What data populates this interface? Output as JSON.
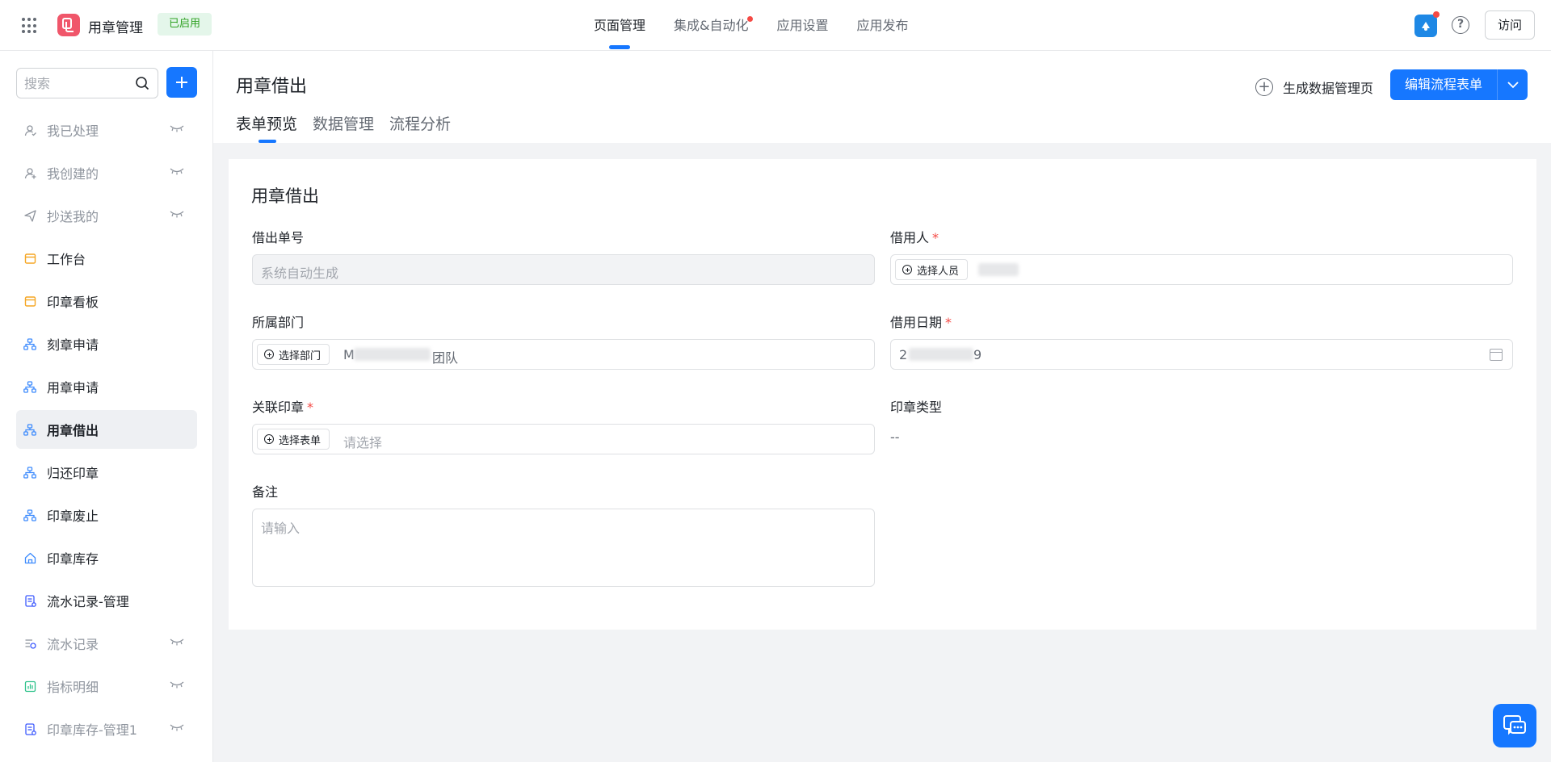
{
  "app": {
    "name": "用章管理",
    "status": "已启用"
  },
  "top_nav": [
    {
      "label": "页面管理",
      "active": true,
      "dot": false
    },
    {
      "label": "集成&自动化",
      "active": false,
      "dot": true
    },
    {
      "label": "应用设置",
      "active": false,
      "dot": false
    },
    {
      "label": "应用发布",
      "active": false,
      "dot": false
    }
  ],
  "header_right": {
    "help": "?",
    "visit": "访问"
  },
  "sidebar": {
    "search_placeholder": "搜索",
    "items": [
      {
        "label": "我已处理",
        "icon": "user-check-icon",
        "muted": true,
        "hidden": true
      },
      {
        "label": "我创建的",
        "icon": "user-add-icon",
        "muted": true,
        "hidden": true
      },
      {
        "label": "抄送我的",
        "icon": "send-icon",
        "muted": true,
        "hidden": true
      },
      {
        "label": "工作台",
        "icon": "dashboard-icon",
        "muted": false,
        "hidden": false
      },
      {
        "label": "印章看板",
        "icon": "board-icon",
        "muted": false,
        "hidden": false
      },
      {
        "label": "刻章申请",
        "icon": "flow-icon",
        "muted": false,
        "hidden": false
      },
      {
        "label": "用章申请",
        "icon": "flow-icon",
        "muted": false,
        "hidden": false
      },
      {
        "label": "用章借出",
        "icon": "flow-icon",
        "muted": false,
        "hidden": false,
        "active": true
      },
      {
        "label": "归还印章",
        "icon": "flow-icon",
        "muted": false,
        "hidden": false
      },
      {
        "label": "印章废止",
        "icon": "flow-icon",
        "muted": false,
        "hidden": false
      },
      {
        "label": "印章库存",
        "icon": "home-icon",
        "muted": false,
        "hidden": false
      },
      {
        "label": "流水记录-管理",
        "icon": "report-icon",
        "muted": false,
        "hidden": false
      },
      {
        "label": "流水记录",
        "icon": "list-icon",
        "muted": true,
        "hidden": true
      },
      {
        "label": "指标明细",
        "icon": "chart-icon",
        "muted": true,
        "hidden": true
      },
      {
        "label": "印章库存-管理1",
        "icon": "report-icon",
        "muted": true,
        "hidden": true
      }
    ]
  },
  "page": {
    "title": "用章借出",
    "tabs": [
      "表单预览",
      "数据管理",
      "流程分析"
    ],
    "generate_label": "生成数据管理页",
    "edit_label": "编辑流程表单"
  },
  "form": {
    "title": "用章借出",
    "order_no": {
      "label": "借出单号",
      "placeholder": "系统自动生成"
    },
    "borrower": {
      "label": "借用人",
      "required": "*",
      "chip": "选择人员"
    },
    "dept": {
      "label": "所属部门",
      "chip": "选择部门",
      "value_head": "M",
      "value_tail": "团队"
    },
    "date": {
      "label": "借用日期",
      "required": "*",
      "value_head": "2",
      "value_tail": "9"
    },
    "seal": {
      "label": "关联印章",
      "required": "*",
      "chip": "选择表单",
      "placeholder": "请选择"
    },
    "seal_type": {
      "label": "印章类型",
      "value": "--"
    },
    "remark": {
      "label": "备注",
      "placeholder": "请输入"
    }
  },
  "colors": {
    "primary": "#1677ff",
    "danger": "#f54a45",
    "logo": "#f0566a",
    "tag_bg": "#e4f6ea",
    "tag_fg": "#2ea121"
  }
}
